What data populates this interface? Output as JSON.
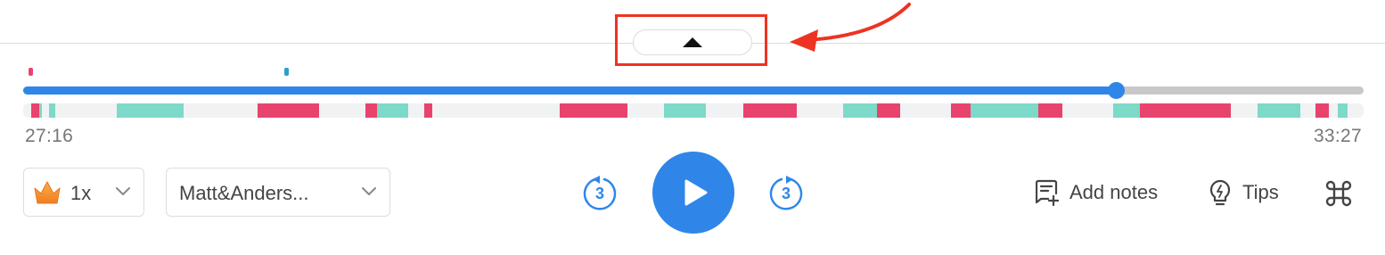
{
  "player": {
    "current_time": "27:16",
    "end_time": "33:27",
    "progress": 0.815,
    "speed_label": "1x",
    "speaker_label": "Matt&Anders...",
    "skip_back_seconds": "3",
    "skip_forward_seconds": "3",
    "add_notes_label": "Add notes",
    "tips_label": "Tips"
  },
  "timeline": {
    "markers": [
      {
        "position": 0.004,
        "color": "#e8436c"
      },
      {
        "position": 0.195,
        "color": "#2c9fc6"
      }
    ],
    "segments": [
      {
        "start": 0.006,
        "end": 0.012,
        "color": "#e8436c"
      },
      {
        "start": 0.012,
        "end": 0.014,
        "color": "#7dd9c8"
      },
      {
        "start": 0.019,
        "end": 0.024,
        "color": "#7dd9c8"
      },
      {
        "start": 0.07,
        "end": 0.12,
        "color": "#7dd9c8"
      },
      {
        "start": 0.175,
        "end": 0.221,
        "color": "#e8436c"
      },
      {
        "start": 0.255,
        "end": 0.264,
        "color": "#e8436c"
      },
      {
        "start": 0.264,
        "end": 0.287,
        "color": "#7dd9c8"
      },
      {
        "start": 0.299,
        "end": 0.305,
        "color": "#e8436c"
      },
      {
        "start": 0.4,
        "end": 0.451,
        "color": "#e8436c"
      },
      {
        "start": 0.478,
        "end": 0.509,
        "color": "#7dd9c8"
      },
      {
        "start": 0.537,
        "end": 0.577,
        "color": "#e8436c"
      },
      {
        "start": 0.612,
        "end": 0.637,
        "color": "#7dd9c8"
      },
      {
        "start": 0.637,
        "end": 0.654,
        "color": "#e8436c"
      },
      {
        "start": 0.692,
        "end": 0.707,
        "color": "#e8436c"
      },
      {
        "start": 0.707,
        "end": 0.757,
        "color": "#7dd9c8"
      },
      {
        "start": 0.757,
        "end": 0.775,
        "color": "#e8436c"
      },
      {
        "start": 0.813,
        "end": 0.833,
        "color": "#7dd9c8"
      },
      {
        "start": 0.833,
        "end": 0.901,
        "color": "#e8436c"
      },
      {
        "start": 0.921,
        "end": 0.953,
        "color": "#7dd9c8"
      },
      {
        "start": 0.964,
        "end": 0.974,
        "color": "#e8436c"
      },
      {
        "start": 0.981,
        "end": 0.988,
        "color": "#7dd9c8"
      }
    ]
  },
  "colors": {
    "accent": "#2f86e8",
    "track": "#c8c8c8",
    "speaker_a": "#e8436c",
    "speaker_b": "#7dd9c8",
    "annotation": "#ee3322"
  },
  "icons": {
    "collapse": "caret-up-icon",
    "speed": "crown-icon",
    "dropdown": "chevron-down-icon",
    "skip_back": "rewind-3-icon",
    "play": "play-icon",
    "skip_forward": "forward-3-icon",
    "notes": "add-notes-icon",
    "tips": "lightbulb-icon",
    "shortcuts": "command-icon"
  }
}
